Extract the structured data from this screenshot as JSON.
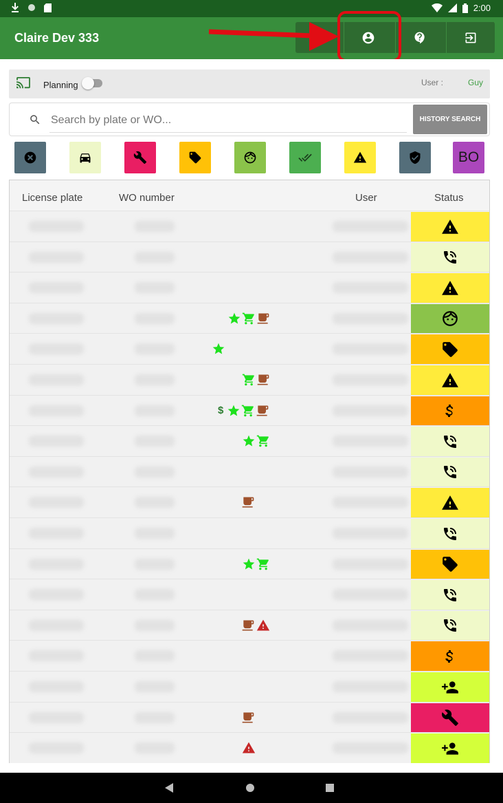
{
  "statusbar": {
    "time": "2:00"
  },
  "appbar": {
    "title": "Claire Dev 333"
  },
  "planning": {
    "label": "Planning",
    "user_label": "User :",
    "user_name": "Guy"
  },
  "search": {
    "placeholder": "Search by plate or WO...",
    "history_button": "HISTORY SEARCH"
  },
  "filters": [
    {
      "name": "cancel",
      "icon": "cancel-icon",
      "color": "#546e7a"
    },
    {
      "name": "car",
      "icon": "car-icon",
      "color": "#eef7c8"
    },
    {
      "name": "wrench",
      "icon": "wrench-icon",
      "color": "#e91e63"
    },
    {
      "name": "tag",
      "icon": "tag-icon",
      "color": "#ffc107"
    },
    {
      "name": "face",
      "icon": "face-icon",
      "color": "#8bc34a"
    },
    {
      "name": "done-all",
      "icon": "done-all-icon",
      "color": "#4caf50"
    },
    {
      "name": "warning",
      "icon": "warning-icon",
      "color": "#ffeb3b"
    },
    {
      "name": "shield",
      "icon": "shield-icon",
      "color": "#546e7a"
    },
    {
      "name": "bo",
      "icon": "bo-text",
      "color": "#ab47bc",
      "text": "BO"
    }
  ],
  "table": {
    "headers": {
      "plate": "License plate",
      "wo": "WO number",
      "user": "User",
      "status": "Status"
    },
    "rows": [
      {
        "icons": [],
        "status": "warning",
        "status_color": "#ffeb3b"
      },
      {
        "icons": [],
        "status": "phone",
        "status_color": "#f0f9c9"
      },
      {
        "icons": [],
        "status": "warning",
        "status_color": "#ffeb3b"
      },
      {
        "icons": [
          "star",
          "cart",
          "coffee"
        ],
        "status": "face",
        "status_color": "#8bc34a"
      },
      {
        "icons": [
          "star"
        ],
        "status": "tag",
        "status_color": "#ffc107"
      },
      {
        "icons": [
          "cart",
          "coffee"
        ],
        "status": "warning",
        "status_color": "#ffeb3b"
      },
      {
        "icons": [
          "dollar",
          "star",
          "cart",
          "coffee"
        ],
        "status": "dollar",
        "status_color": "#ff9800"
      },
      {
        "icons": [
          "star",
          "cart"
        ],
        "status": "phone",
        "status_color": "#f0f9c9"
      },
      {
        "icons": [],
        "status": "phone",
        "status_color": "#f0f9c9"
      },
      {
        "icons": [
          "coffee"
        ],
        "status": "warning",
        "status_color": "#ffeb3b"
      },
      {
        "icons": [],
        "status": "phone",
        "status_color": "#f0f9c9"
      },
      {
        "icons": [
          "star",
          "cart"
        ],
        "status": "tag",
        "status_color": "#ffc107"
      },
      {
        "icons": [],
        "status": "phone",
        "status_color": "#f0f9c9"
      },
      {
        "icons": [
          "coffee",
          "alert"
        ],
        "status": "phone",
        "status_color": "#f0f9c9"
      },
      {
        "icons": [],
        "status": "dollar",
        "status_color": "#ff9800"
      },
      {
        "icons": [],
        "status": "person-add",
        "status_color": "#d4ff3a"
      },
      {
        "icons": [
          "coffee"
        ],
        "status": "wrench",
        "status_color": "#e91e63"
      },
      {
        "icons": [
          "alert"
        ],
        "status": "person-add",
        "status_color": "#d4ff3a"
      }
    ]
  }
}
